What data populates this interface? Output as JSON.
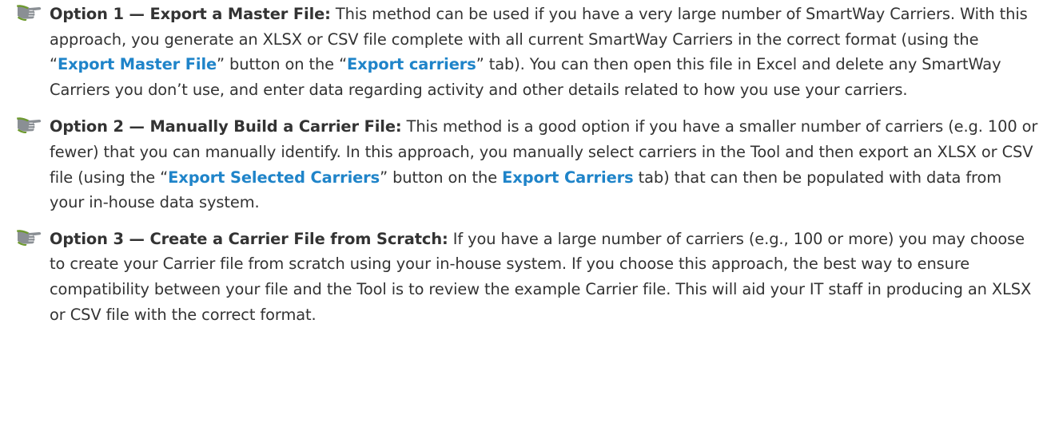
{
  "colors": {
    "text": "#333333",
    "link": "#1f84c9",
    "bullet_green": "#6e9a2f",
    "bullet_grey": "#8a8f94"
  },
  "icons": {
    "bullet": "pointing-hand-icon"
  },
  "options": [
    {
      "title": "Option 1 — Export a Master File:",
      "segments": [
        " This method can be used if you have a very large number of SmartWay Carriers. With this approach, you generate an XLSX or CSV file complete with all current SmartWay Carriers in the correct format (using the “",
        "Export Master File",
        "” button on the “",
        "Export carriers",
        "” tab). You can then open this file in Excel and delete any SmartWay Carriers you don’t use, and enter data regarding activity and other details related to how you use your carriers."
      ]
    },
    {
      "title": "Option 2 — Manually Build a Carrier File:",
      "segments": [
        " This method is a good option if you have a smaller number of carriers (e.g. 100 or fewer) that you can manually identify. In this approach, you manually select carriers in the Tool and then export an XLSX or CSV file (using the “",
        "Export Selected Carriers",
        "” button on the ",
        "Export Carriers",
        " tab) that can then be populated with data from your in-house data system."
      ]
    },
    {
      "title": "Option 3 — Create a Carrier File from Scratch:",
      "segments": [
        " If you have a large number of carriers (e.g., 100 or more) you may choose to create your Carrier file from scratch using your in-house system. If you choose this approach, the best way to ensure compatibility between your file and the Tool is to review the example Carrier file. This will aid your IT staff in producing an XLSX or CSV file with the correct format."
      ]
    }
  ]
}
